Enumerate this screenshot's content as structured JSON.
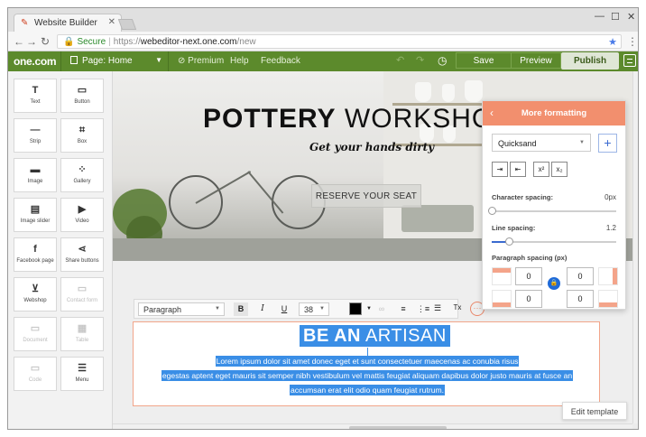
{
  "browser": {
    "tab_title": "Website Builder",
    "secure_label": "Secure",
    "url_scheme": "https://",
    "url_host": "webeditor-next.one.com",
    "url_path": "/new"
  },
  "appbar": {
    "logo": "one.com",
    "page_selector": "Page: Home",
    "premium": "Premium",
    "help": "Help",
    "feedback": "Feedback",
    "save": "Save",
    "preview": "Preview",
    "publish": "Publish"
  },
  "sidebar": {
    "items": [
      {
        "label": "Text",
        "icon": "text-icon",
        "glyph": "T"
      },
      {
        "label": "Button",
        "icon": "button-icon",
        "glyph": "▭"
      },
      {
        "label": "Strip",
        "icon": "strip-icon",
        "glyph": "—"
      },
      {
        "label": "Box",
        "icon": "box-icon",
        "glyph": "⌗"
      },
      {
        "label": "Image",
        "icon": "image-icon",
        "glyph": "▬"
      },
      {
        "label": "Gallery",
        "icon": "gallery-icon",
        "glyph": "⁘"
      },
      {
        "label": "Image slider",
        "icon": "image-slider-icon",
        "glyph": "▤"
      },
      {
        "label": "Video",
        "icon": "video-icon",
        "glyph": "▶"
      },
      {
        "label": "Facebook page",
        "icon": "facebook-icon",
        "glyph": "f"
      },
      {
        "label": "Share buttons",
        "icon": "share-icon",
        "glyph": "⋖"
      },
      {
        "label": "Webshop",
        "icon": "cart-icon",
        "glyph": "⊻"
      },
      {
        "label": "Contact form",
        "icon": "contact-form-icon",
        "glyph": "▭"
      },
      {
        "label": "Document",
        "icon": "document-icon",
        "glyph": "▭"
      },
      {
        "label": "Table",
        "icon": "table-icon",
        "glyph": "▦"
      },
      {
        "label": "Code",
        "icon": "code-icon",
        "glyph": "▭"
      },
      {
        "label": "Menu",
        "icon": "menu-icon",
        "glyph": "☰"
      }
    ]
  },
  "hero": {
    "title_bold": "POTTERY",
    "title_light": " WORKSHOP",
    "subtitle": "Get your hands dirty",
    "button": "RESERVE YOUR SEAT"
  },
  "toolbar": {
    "style": "Paragraph",
    "font_size": "38",
    "bold": "B",
    "italic": "I",
    "underline": "U",
    "clear_format": "Tx",
    "more": "···"
  },
  "textblock": {
    "heading_bold": "BE AN",
    "heading_light": " ARTISAN",
    "lines": [
      "Lorem ipsum dolor sit amet donec eget et sunt consectetuer maecenas ac conubia risus",
      "egestas aptent eget mauris sit semper nibh vestibulum vel mattis feugiat aliquam dapibus dolor justo mauris at fusce an",
      "accumsan erat elit odio quam feugiat rutrum."
    ]
  },
  "edit_template": "Edit template",
  "panel": {
    "title": "More formatting",
    "font": "Quicksand",
    "superscript": "x²",
    "subscript": "x₂",
    "char_spacing_label": "Character spacing:",
    "char_spacing_value": "0px",
    "char_spacing_level": 0,
    "line_spacing_label": "Line spacing:",
    "line_spacing_value": "1.2",
    "line_spacing_level": 0.14,
    "para_spacing_label": "Paragraph spacing (px)",
    "spacing_top": "0",
    "spacing_bottom": "0",
    "spacing_right_top": "0",
    "spacing_right_bottom": "0"
  },
  "colors": {
    "accent": "#f28f6e",
    "brand_green": "#5c8a2c",
    "selection": "#3a8ee6",
    "link_blue": "#3a6ad0"
  }
}
